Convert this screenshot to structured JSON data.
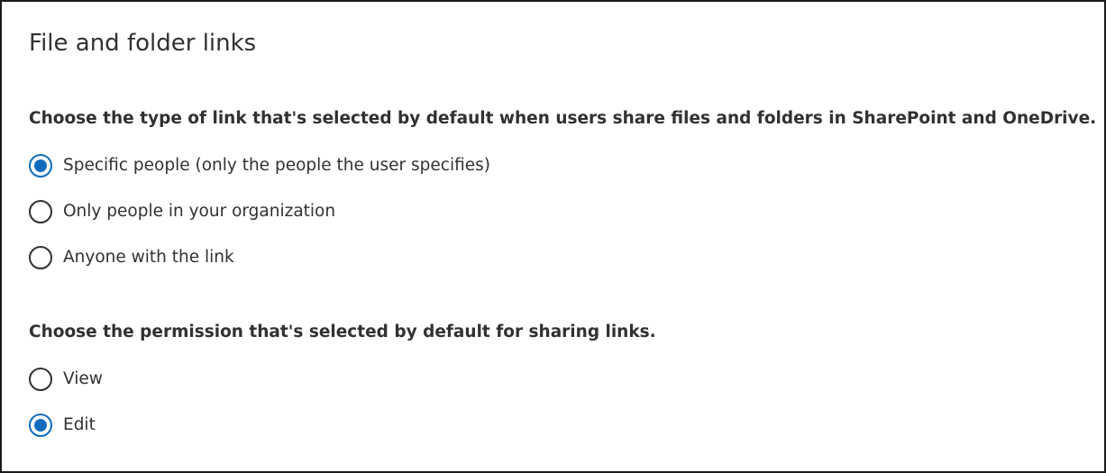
{
  "panel": {
    "title": "File and folder links"
  },
  "link_type": {
    "question": "Choose the type of link that's selected by default when users share files and folders in SharePoint and OneDrive.",
    "options": [
      {
        "label": "Specific people (only the people the user specifies)",
        "selected": true
      },
      {
        "label": "Only people in your organization",
        "selected": false
      },
      {
        "label": "Anyone with the link",
        "selected": false
      }
    ]
  },
  "permission": {
    "question": "Choose the permission that's selected by default for sharing links.",
    "options": [
      {
        "label": "View",
        "selected": false
      },
      {
        "label": "Edit",
        "selected": true
      }
    ]
  },
  "colors": {
    "accent": "#0f6cbd",
    "text": "#323130",
    "border": "#1b1a19"
  }
}
